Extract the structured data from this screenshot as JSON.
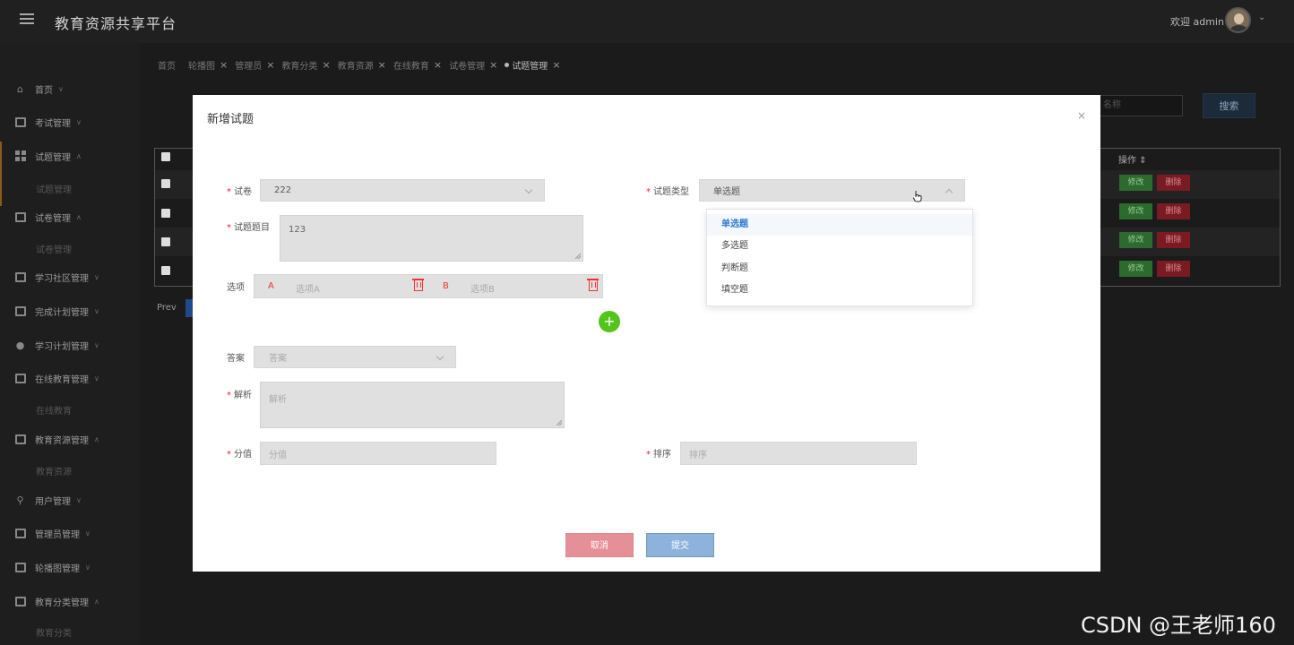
{
  "header": {
    "title": "教育资源共享平台",
    "welcome": "欢迎 admin"
  },
  "sidebar": {
    "items": [
      {
        "label": "首页",
        "icon": "home-icon"
      },
      {
        "label": "考试管理",
        "icon": "exam-icon"
      },
      {
        "label": "试题管理",
        "icon": "question-icon",
        "sub": "试题管理"
      },
      {
        "label": "试卷管理",
        "icon": "paper-icon",
        "sub": "试卷管理"
      },
      {
        "label": "学习社区管理",
        "icon": "community-icon"
      },
      {
        "label": "完成计划管理",
        "icon": "plan-done-icon"
      },
      {
        "label": "学习计划管理",
        "icon": "study-plan-icon"
      },
      {
        "label": "在线教育管理",
        "icon": "online-edu-icon",
        "sub": "在线教育"
      },
      {
        "label": "教育资源管理",
        "icon": "resource-icon",
        "sub": "教育资源"
      },
      {
        "label": "用户管理",
        "icon": "user-icon"
      },
      {
        "label": "管理员管理",
        "icon": "admin-icon"
      },
      {
        "label": "轮播图管理",
        "icon": "carousel-icon"
      },
      {
        "label": "教育分类管理",
        "icon": "category-icon",
        "sub": "教育分类"
      }
    ]
  },
  "tabs": [
    "首页",
    "轮播图",
    "管理员",
    "教育分类",
    "教育资源",
    "在线教育",
    "试卷管理",
    "试题管理"
  ],
  "main": {
    "search_placeholder": "名称",
    "search_button": "搜索",
    "col_action": "操作",
    "edit_label": "修改",
    "delete_label": "删除",
    "prev_label": "Prev"
  },
  "modal": {
    "title": "新增试题",
    "close": "×",
    "paper_label": "试卷",
    "paper_value": "222",
    "type_label": "试题类型",
    "type_value": "单选题",
    "question_label": "试题题目",
    "question_value": "123",
    "options_label": "选项",
    "option_a_letter": "A",
    "option_a_placeholder": "选项A",
    "option_b_letter": "B",
    "option_b_placeholder": "选项B",
    "add_symbol": "+",
    "answer_label": "答案",
    "answer_placeholder": "答案",
    "analysis_label": "解析",
    "analysis_placeholder": "解析",
    "score_label": "分值",
    "score_placeholder": "分值",
    "sort_label": "排序",
    "sort_placeholder": "排序",
    "cancel_label": "取消",
    "submit_label": "提交",
    "type_options": [
      "单选题",
      "多选题",
      "判断题",
      "填空题"
    ]
  },
  "watermark": "CSDN @王老师160",
  "colors": {
    "required": "#e22233",
    "selected_option": "#2e7bd6",
    "add_button": "#52c41a",
    "cancel_button": "#e58f98",
    "submit_button": "#8db3dd"
  }
}
